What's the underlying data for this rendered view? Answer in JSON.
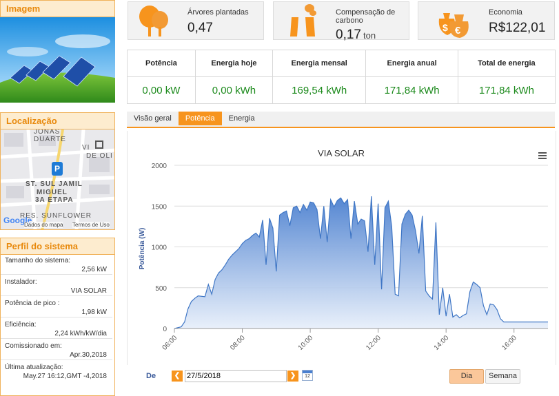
{
  "sidebar": {
    "image_header": "Imagem",
    "location_header": "Localização",
    "map": {
      "labels": [
        "JONAS",
        "DUARTE",
        "VI",
        "DE OLI",
        "ST. SUL JAMIL",
        "MIGUEL",
        "3A ETAPA",
        "RES. SUNFLOWER"
      ],
      "google_logo": "Google",
      "map_data": "Dados do mapa",
      "terms": "Termos de Uso"
    },
    "profile": {
      "header": "Perfil do sistema",
      "rows": [
        {
          "key": "Tamanho do sistema:",
          "value": "2,56 kW"
        },
        {
          "key": "Instalador:",
          "value": "VIA SOLAR"
        },
        {
          "key": "Potência de pico :",
          "value": "1,98 kW"
        },
        {
          "key": "Eficiência:",
          "value": "2,24 kWh/kW/dia"
        },
        {
          "key": "Comissionado em:",
          "value": "Apr.30,2018"
        },
        {
          "key": "Última atualização:",
          "value": "May.27 16:12,GMT -4,2018"
        }
      ]
    }
  },
  "stats": {
    "trees": {
      "label": "Árvores plantadas",
      "value": "0,47"
    },
    "carbon": {
      "label_line1": "Compensação de",
      "label_line2": "carbono",
      "value": "0,17",
      "unit": "ton"
    },
    "savings": {
      "label": "Economia",
      "value": "R$122,01"
    }
  },
  "energy_table": {
    "headers": [
      "Potência",
      "Energia hoje",
      "Energia mensal",
      "Energia anual",
      "Total de energia"
    ],
    "values": [
      "0,00 kW",
      "0,00 kWh",
      "169,54 kWh",
      "171,84 kWh",
      "171,84 kWh"
    ]
  },
  "tabs": {
    "overview": "Visão geral",
    "power": "Potência",
    "energy": "Energia"
  },
  "controls": {
    "from_label": "De",
    "date_value": "27/5/2018",
    "calendar_day": "12",
    "day_button": "Dia",
    "week_button": "Semana"
  },
  "colors": {
    "accent": "#f7941d",
    "header_text": "#e8890c",
    "value_green": "#1c8a1c",
    "chart_line": "#3f76c5"
  },
  "chart_data": {
    "type": "area",
    "title": "VIA SOLAR",
    "ylabel": "Potência (W)",
    "xlabel": "",
    "ylim": [
      0,
      2000
    ],
    "xlim_hours": [
      6.0,
      17.0
    ],
    "grid": true,
    "y_ticks": [
      "0",
      "500",
      "1000",
      "1500",
      "2000"
    ],
    "x_ticks": [
      "06:00",
      "08:00",
      "10:00",
      "12:00",
      "14:00",
      "16:00"
    ],
    "series": [
      {
        "x": [
          6.0,
          6.2,
          6.3,
          6.4,
          6.5,
          6.6,
          6.7,
          6.9,
          7.0,
          7.1,
          7.2,
          7.3,
          7.4,
          7.5,
          7.6,
          7.7,
          7.8,
          7.9,
          8.0,
          8.1,
          8.2,
          8.3,
          8.4,
          8.5,
          8.6,
          8.7,
          8.8,
          8.9,
          9.0,
          9.1,
          9.2,
          9.3,
          9.4,
          9.5,
          9.6,
          9.7,
          9.8,
          9.9,
          10.0,
          10.1,
          10.2,
          10.3,
          10.4,
          10.5,
          10.6,
          10.7,
          10.8,
          10.9,
          11.0,
          11.1,
          11.2,
          11.3,
          11.4,
          11.5,
          11.6,
          11.7,
          11.8,
          11.9,
          12.0,
          12.1,
          12.2,
          12.3,
          12.4,
          12.5,
          12.6,
          12.7,
          12.8,
          12.9,
          13.0,
          13.1,
          13.2,
          13.3,
          13.4,
          13.5,
          13.6,
          13.7,
          13.8,
          13.9,
          14.0,
          14.1,
          14.2,
          14.3,
          14.4,
          14.5,
          14.6,
          14.7,
          14.8,
          14.9,
          15.0,
          15.1,
          15.2,
          15.3,
          15.4,
          15.5,
          15.6,
          15.7,
          15.8,
          15.9,
          16.0,
          16.1,
          16.2,
          16.3,
          16.4,
          16.5,
          16.6,
          16.8,
          17.0
        ],
        "y": [
          0,
          20,
          80,
          240,
          330,
          370,
          400,
          390,
          540,
          420,
          600,
          680,
          720,
          780,
          850,
          900,
          940,
          980,
          1040,
          1080,
          1100,
          1140,
          1170,
          1120,
          1330,
          780,
          1350,
          1230,
          700,
          1390,
          1420,
          1440,
          1260,
          1480,
          1500,
          1420,
          1520,
          1450,
          1550,
          1540,
          1460,
          1100,
          1500,
          1060,
          1580,
          1490,
          1570,
          1600,
          1530,
          1580,
          1100,
          1560,
          1280,
          1340,
          1320,
          940,
          1620,
          780,
          1530,
          480,
          1480,
          1560,
          1250,
          420,
          400,
          1280,
          1400,
          1450,
          1390,
          1200,
          920,
          1380,
          460,
          400,
          360,
          1300,
          170,
          500,
          150,
          420,
          140,
          170,
          130,
          160,
          180,
          450,
          570,
          540,
          500,
          280,
          170,
          300,
          290,
          230,
          120,
          80,
          80,
          80,
          80,
          80,
          80,
          80,
          80,
          80,
          80,
          80,
          80
        ]
      }
    ]
  }
}
